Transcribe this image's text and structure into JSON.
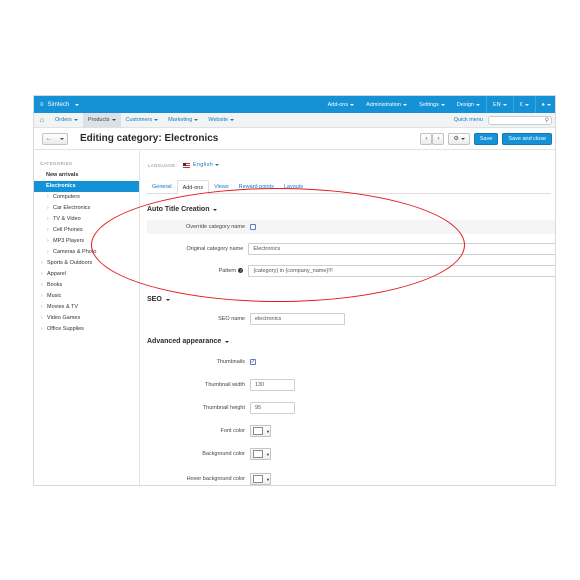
{
  "topbar": {
    "store": "Simtech",
    "menus": [
      "Add-ons",
      "Administration",
      "Settings",
      "Design",
      "EN",
      "€"
    ]
  },
  "nav": {
    "items": [
      "Orders",
      "Products",
      "Customers",
      "Marketing",
      "Website"
    ],
    "active": "Products",
    "quick_menu": "Quick menu"
  },
  "title": "Editing category: Electronics",
  "header_buttons": {
    "save": "Save",
    "save_close": "Save and close"
  },
  "sidebar": {
    "heading": "CATEGORIES",
    "items": [
      {
        "label": "New arrivals",
        "level": "top",
        "bold": true
      },
      {
        "label": "Electronics",
        "level": "top",
        "active": true
      },
      {
        "label": "Computers",
        "level": "sub"
      },
      {
        "label": "Car Electronics",
        "level": "sub"
      },
      {
        "label": "TV & Video",
        "level": "sub"
      },
      {
        "label": "Cell Phones",
        "level": "sub"
      },
      {
        "label": "MP3 Players",
        "level": "sub"
      },
      {
        "label": "Cameras & Photo",
        "level": "sub"
      },
      {
        "label": "Sports & Outdoors",
        "level": "top"
      },
      {
        "label": "Apparel",
        "level": "top"
      },
      {
        "label": "Books",
        "level": "top"
      },
      {
        "label": "Music",
        "level": "top"
      },
      {
        "label": "Movies & TV",
        "level": "top"
      },
      {
        "label": "Video Games",
        "level": "top"
      },
      {
        "label": "Office Supplies",
        "level": "top"
      }
    ]
  },
  "language": {
    "label": "LANGUAGE:",
    "value": "English"
  },
  "tabs": [
    "General",
    "Add-ons",
    "Views",
    "Reward points",
    "Layouts"
  ],
  "active_tab": "Add-ons",
  "auto_title": {
    "heading": "Auto Title Creation",
    "override_label": "Override category name",
    "override_checked": false,
    "original_label": "Original category name",
    "original_value": "Electronics",
    "pattern_label": "Pattern",
    "pattern_value": "{category} in {company_name}!!!"
  },
  "seo": {
    "heading": "SEO",
    "name_label": "SEO name",
    "name_value": "electronics"
  },
  "advanced": {
    "heading": "Advanced appearance",
    "thumbnails_label": "Thumbnails",
    "thumbnails_checked": true,
    "thumb_width_label": "Thumbnail width",
    "thumb_width_value": "130",
    "thumb_height_label": "Thumbnail height",
    "thumb_height_value": "95",
    "font_color_label": "Font color",
    "bg_color_label": "Background color",
    "hover_bg_label": "Hover background color"
  },
  "colors": {
    "primary": "#1592d6",
    "annotation": "#e31b1b"
  }
}
